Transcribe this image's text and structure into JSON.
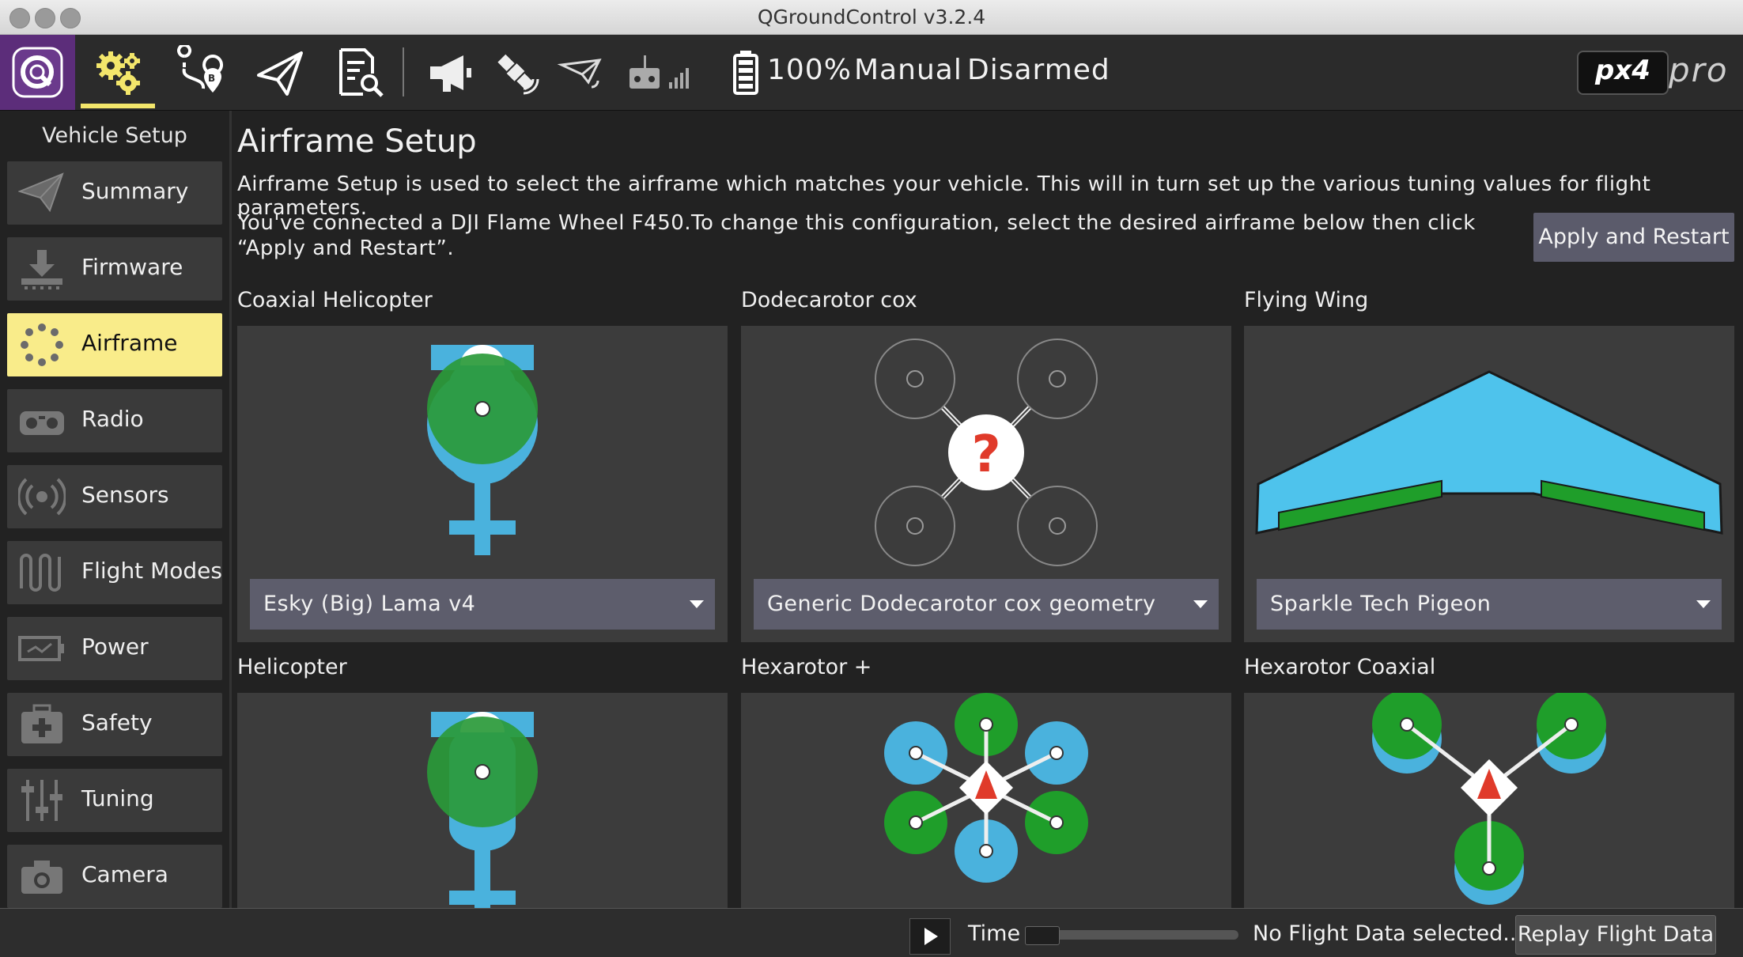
{
  "window": {
    "title": "QGroundControl v3.2.4"
  },
  "toolbar": {
    "battery": "100%",
    "flight_mode": "Manual",
    "arm_state": "Disarmed",
    "brand_logo": "px4",
    "brand_suffix": "pro",
    "icons": [
      "qgc-logo-icon",
      "vehicle-setup-gear-icon",
      "plan-view-icon",
      "fly-view-icon",
      "analyze-icon",
      "messages-megaphone-icon",
      "gps-satellite-icon",
      "telemetry-link-icon",
      "rc-rssi-icon",
      "battery-icon"
    ],
    "accent": "#f3e66b"
  },
  "sidebar": {
    "title": "Vehicle Setup",
    "items": [
      {
        "label": "Summary",
        "icon": "paper-plane-icon"
      },
      {
        "label": "Firmware",
        "icon": "firmware-download-icon"
      },
      {
        "label": "Airframe",
        "icon": "airframe-dots-icon",
        "active": true
      },
      {
        "label": "Radio",
        "icon": "radio-transmitter-icon"
      },
      {
        "label": "Sensors",
        "icon": "sensors-radar-icon"
      },
      {
        "label": "Flight Modes",
        "icon": "flight-modes-wave-icon"
      },
      {
        "label": "Power",
        "icon": "power-battery-icon"
      },
      {
        "label": "Safety",
        "icon": "safety-first-aid-icon"
      },
      {
        "label": "Tuning",
        "icon": "tuning-sliders-icon"
      },
      {
        "label": "Camera",
        "icon": "camera-icon"
      }
    ],
    "active_color": "#f9ec8a"
  },
  "main": {
    "title": "Airframe Setup",
    "description": "Airframe Setup is used to select the airframe which matches your vehicle. This will in turn set up the various tuning values for flight parameters.",
    "connected_text": "You've connected a DJI Flame Wheel F450.To change this configuration, select the desired airframe below then click “Apply and Restart”.",
    "apply_label": "Apply and Restart",
    "airframes": [
      {
        "name": "Coaxial Helicopter",
        "selected": "Esky (Big) Lama v4"
      },
      {
        "name": "Dodecarotor cox",
        "selected": "Generic Dodecarotor cox geometry"
      },
      {
        "name": "Flying Wing",
        "selected": "Sparkle Tech Pigeon"
      },
      {
        "name": "Helicopter"
      },
      {
        "name": "Hexarotor +"
      },
      {
        "name": "Hexarotor Coaxial"
      }
    ]
  },
  "bottombar": {
    "time_label": "Time",
    "status": "No Flight Data selected..",
    "replay_label": "Replay Flight Data"
  }
}
